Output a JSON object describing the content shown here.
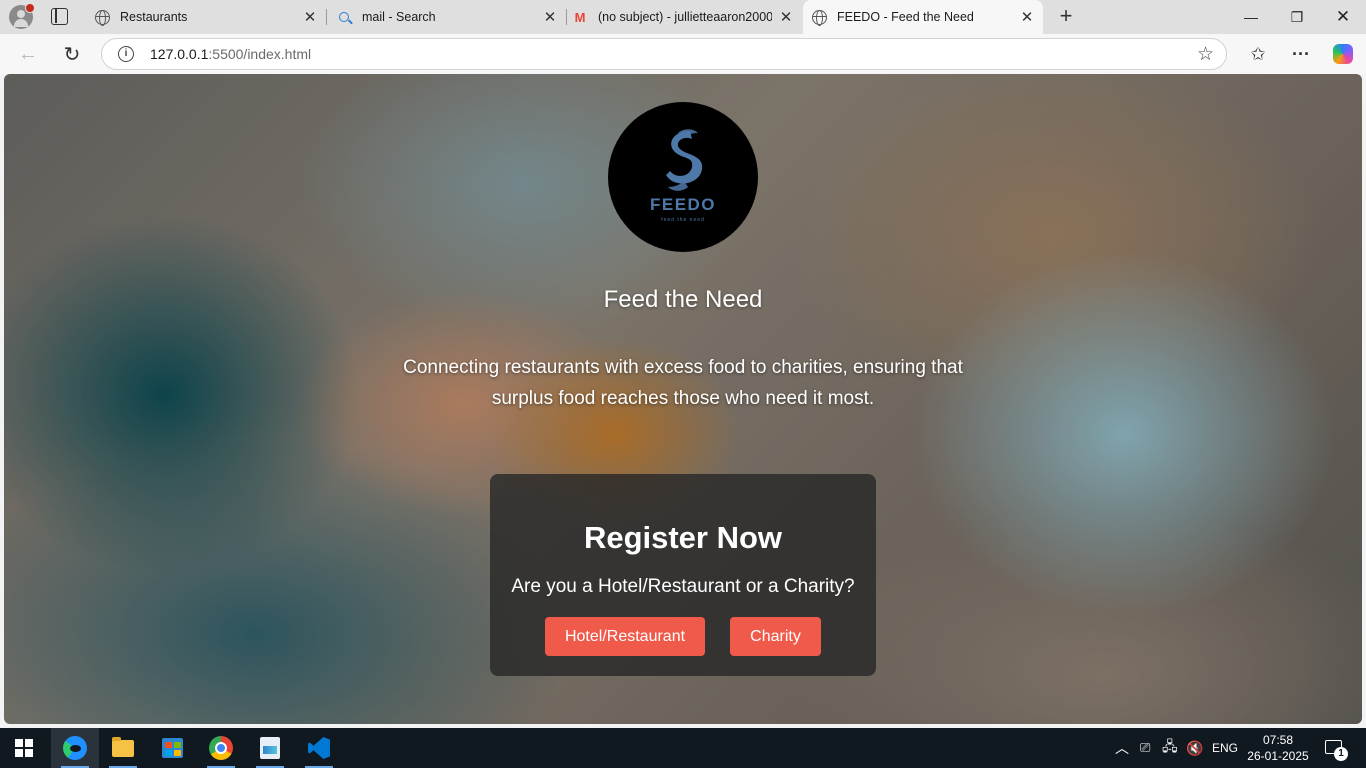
{
  "browser": {
    "tabs": [
      {
        "title": "Restaurants",
        "icon": "globe-icon"
      },
      {
        "title": "mail - Search",
        "icon": "search-icon"
      },
      {
        "title": "(no subject) - jullietteaaron2000@",
        "icon": "gmail-icon"
      },
      {
        "title": "FEEDO - Feed the Need",
        "icon": "globe-icon",
        "active": true
      }
    ],
    "address": {
      "host": "127.0.0.1",
      "path": ":5500/index.html"
    }
  },
  "page": {
    "logo": {
      "name": "FEEDO",
      "tagline": "feed the need",
      "bg_color": "#000000",
      "accent_color": "#4e78a8"
    },
    "tagline": "Feed the Need",
    "description": "Connecting restaurants with excess food to charities, ensuring that surplus food reaches those who need it most.",
    "register": {
      "title": "Register Now",
      "question": "Are you a Hotel/Restaurant or a Charity?",
      "buttons": [
        "Hotel/Restaurant",
        "Charity"
      ],
      "button_color": "#f05a4a"
    }
  },
  "taskbar": {
    "apps": [
      "start-icon",
      "edge-icon",
      "file-explorer-icon",
      "store-icon",
      "chrome-icon",
      "paint-icon",
      "vscode-icon"
    ],
    "language": "ENG",
    "time": "07:58",
    "date": "26-01-2025",
    "notifications": "1"
  }
}
